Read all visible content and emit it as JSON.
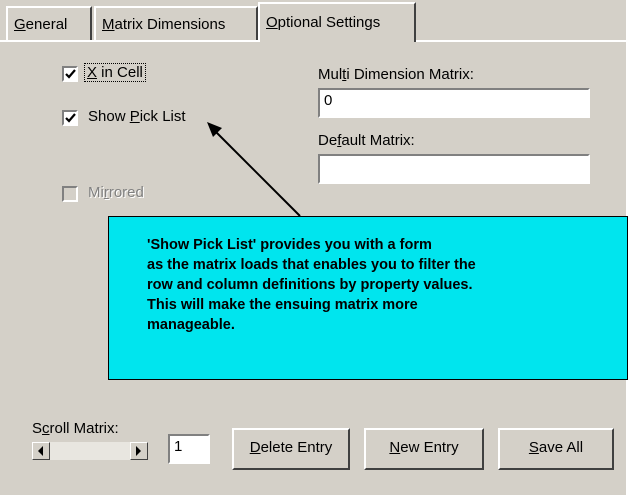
{
  "tabs": [
    {
      "pre": "",
      "key": "G",
      "post": "eneral"
    },
    {
      "pre": "",
      "key": "M",
      "post": "atrix Dimensions"
    },
    {
      "pre": "",
      "key": "O",
      "post": "ptional Settings"
    }
  ],
  "options": {
    "x_in_cell": {
      "pre": "",
      "key": "X",
      "post": " in Cell",
      "checked": true
    },
    "show_pick_list": {
      "pre": "Show ",
      "key": "P",
      "post": "ick List",
      "checked": true
    },
    "mirrored": {
      "pre": "Mi",
      "key": "r",
      "post": "rored",
      "checked": false,
      "enabled": false
    }
  },
  "multi_dimension_matrix": {
    "label_pre": "Mul",
    "label_key": "t",
    "label_post": "i Dimension Matrix:",
    "value": "0"
  },
  "default_matrix": {
    "label_pre": "De",
    "label_key": "f",
    "label_post": "ault Matrix:",
    "value": ""
  },
  "callout": {
    "lines": [
      "'Show Pick List' provides you with a form",
      "as the matrix loads that enables you to filter the",
      "row and column definitions by property values.",
      "This will make the ensuing matrix more",
      "manageable."
    ],
    "color": "#00e5ee"
  },
  "scroll_matrix": {
    "label_pre": "S",
    "label_key": "c",
    "label_post": "roll Matrix:",
    "value": "1"
  },
  "buttons": {
    "delete": {
      "pre": "",
      "key": "D",
      "post": "elete Entry"
    },
    "new": {
      "pre": "",
      "key": "N",
      "post": "ew Entry"
    },
    "save": {
      "pre": "",
      "key": "S",
      "post": "ave All"
    }
  }
}
